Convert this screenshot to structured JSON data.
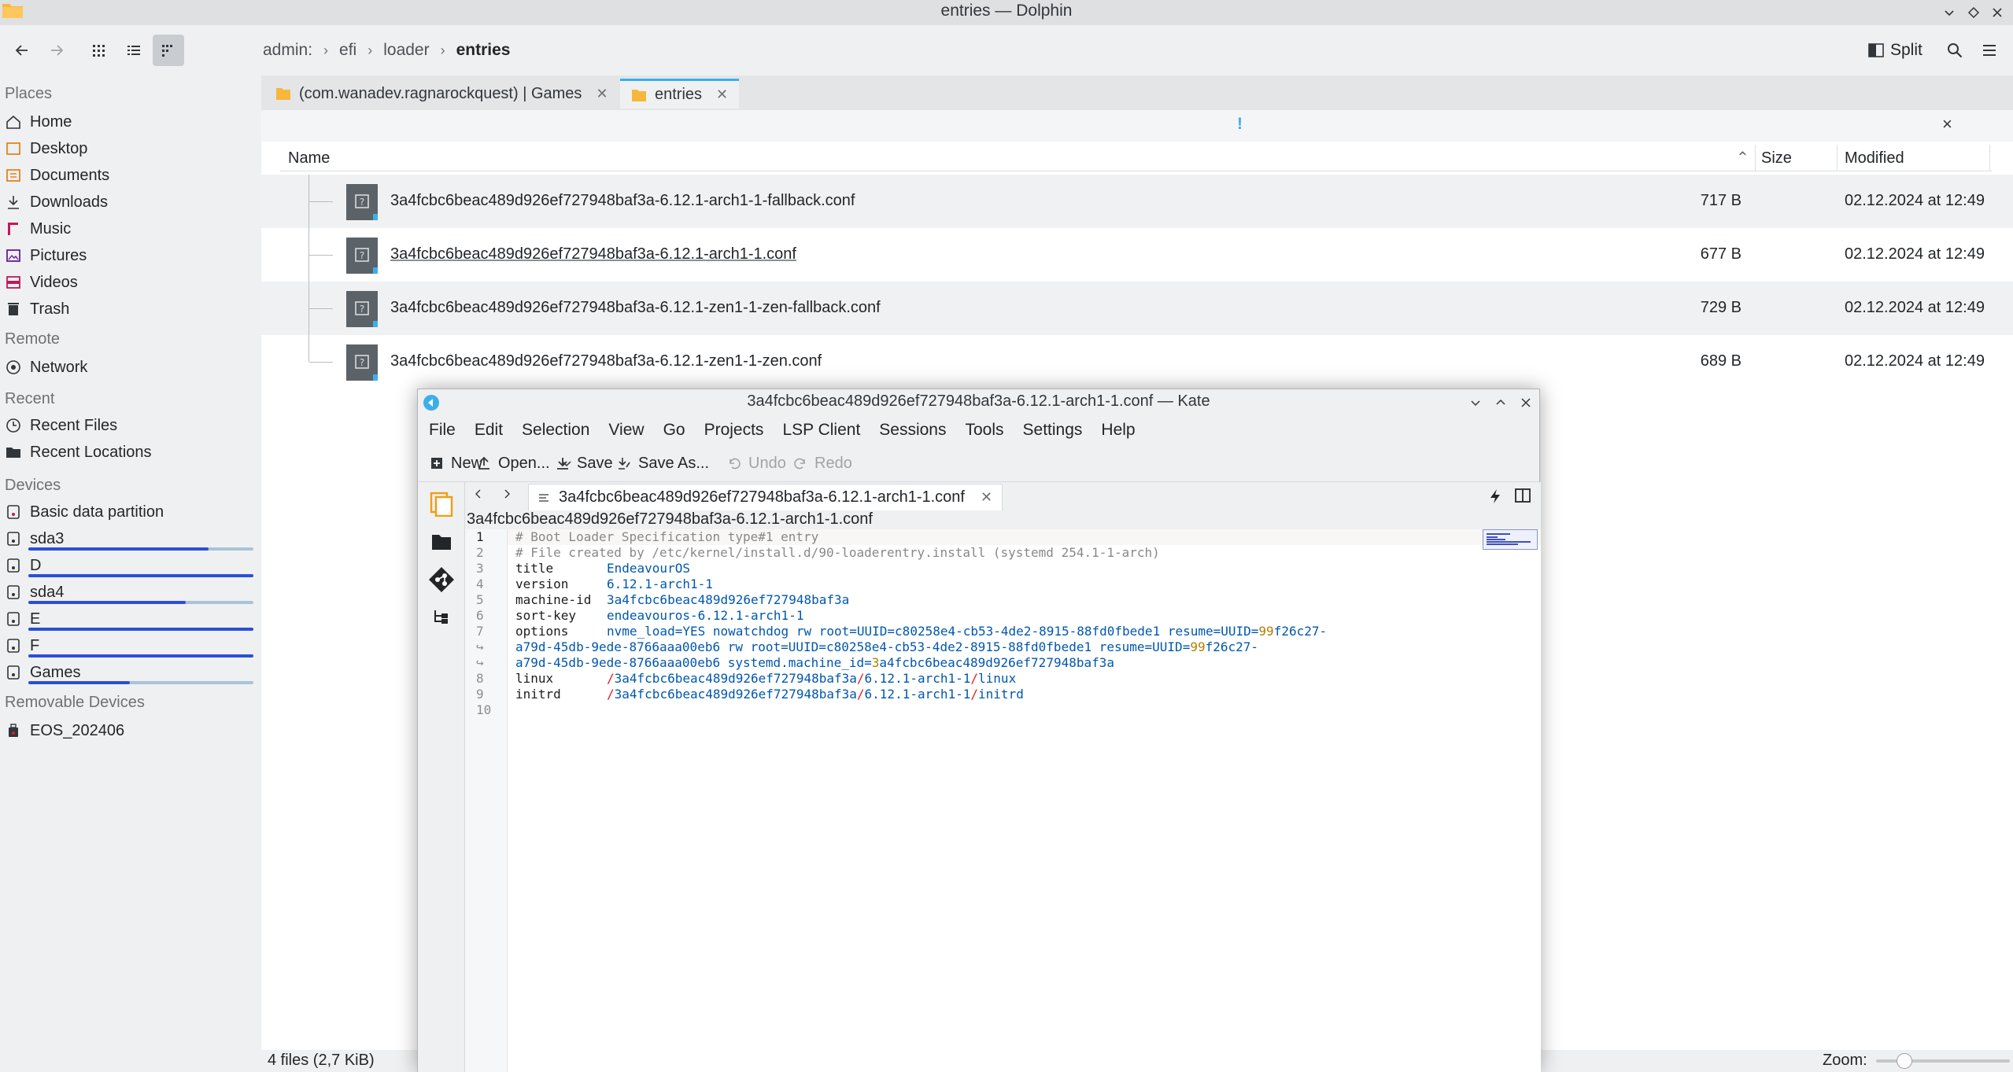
{
  "dolphin": {
    "title": "entries — Dolphin",
    "breadcrumb": [
      "admin:",
      "efi",
      "loader",
      "entries"
    ],
    "split_label": "Split",
    "tabs": [
      {
        "label": "(com.wanadev.ragnarockquest) | Games"
      },
      {
        "label": "entries"
      }
    ],
    "infobar_mark": "!",
    "infobar_close": "×",
    "columns": {
      "name": "Name",
      "size": "Size",
      "modified": "Modified"
    },
    "files": [
      {
        "name": "3a4fcbc6beac489d926ef727948baf3a-6.12.1-arch1-1-fallback.conf",
        "size": "717 B",
        "modified": "02.12.2024 at 12:49"
      },
      {
        "name": "3a4fcbc6beac489d926ef727948baf3a-6.12.1-arch1-1.conf",
        "size": "677 B",
        "modified": "02.12.2024 at 12:49"
      },
      {
        "name": "3a4fcbc6beac489d926ef727948baf3a-6.12.1-zen1-1-zen-fallback.conf",
        "size": "729 B",
        "modified": "02.12.2024 at 12:49"
      },
      {
        "name": "3a4fcbc6beac489d926ef727948baf3a-6.12.1-zen1-1-zen.conf",
        "size": "689 B",
        "modified": "02.12.2024 at 12:49"
      }
    ],
    "status_text": "4 files (2,7 KiB)",
    "zoom_label": "Zoom:"
  },
  "places": {
    "sections": {
      "places": "Places",
      "remote": "Remote",
      "recent": "Recent",
      "devices": "Devices",
      "removable": "Removable Devices"
    },
    "places_items": [
      "Home",
      "Desktop",
      "Documents",
      "Downloads",
      "Music",
      "Pictures",
      "Videos",
      "Trash"
    ],
    "remote_items": [
      "Network"
    ],
    "recent_items": [
      "Recent Files",
      "Recent Locations"
    ],
    "devices": [
      {
        "label": "Basic data partition",
        "usage": null
      },
      {
        "label": "sda3",
        "usage": 0.8
      },
      {
        "label": "D",
        "usage": 1.0
      },
      {
        "label": "sda4",
        "usage": 0.7
      },
      {
        "label": "E",
        "usage": 1.0
      },
      {
        "label": "F",
        "usage": 1.0
      },
      {
        "label": "Games",
        "usage": 0.45
      }
    ],
    "removable_items": [
      "EOS_202406"
    ]
  },
  "kate": {
    "title": "3a4fcbc6beac489d926ef727948baf3a-6.12.1-arch1-1.conf — Kate",
    "menu": [
      "File",
      "Edit",
      "Selection",
      "View",
      "Go",
      "Projects",
      "LSP Client",
      "Sessions",
      "Tools",
      "Settings",
      "Help"
    ],
    "toolbar": {
      "new": "New",
      "open": "Open...",
      "save": "Save",
      "save_as": "Save As...",
      "undo": "Undo",
      "redo": "Redo"
    },
    "doc_tab": "3a4fcbc6beac489d926ef727948baf3a-6.12.1-arch1-1.conf",
    "path": "3a4fcbc6beac489d926ef727948baf3a-6.12.1-arch1-1.conf",
    "line_numbers": [
      "1",
      "2",
      "3",
      "4",
      "5",
      "6",
      "7",
      "",
      "",
      "8",
      "9",
      "10"
    ],
    "lines": {
      "l1": "# Boot Loader Specification type#1 entry",
      "l2": "# File created by /etc/kernel/install.d/90-loaderentry.install (systemd 254.1-1-arch)",
      "l3k": "title",
      "l3v": "EndeavourOS",
      "l4k": "version",
      "l4v": "6.12.1-arch1-1",
      "l5k": "machine-id",
      "l5v": "3a4fcbc6beac489d926ef727948baf3a",
      "l6k": "sort-key",
      "l6v": "endeavouros-6.12.1-arch1-1",
      "l7k": "options",
      "l7a": "nvme_load=YES nowatchdog rw root=UUID=c80258e4-cb53-4de2-8915-88fd0fbede1 resume=UUID=",
      "l7b": "99",
      "l7c": "f26c27-",
      "w1a": "a79d-45db-9ede-8766aaa00eb6 rw root=UUID=c80258e4-cb53-4de2-8915-88fd0fbede1 resume=UUID=",
      "w1b": "99",
      "w1c": "f26c27-",
      "w2a": "a79d-45db-9ede-8766aaa00eb6 systemd.machine_id=",
      "w2b": "3",
      "w2c": "a4fcbc6beac489d926ef727948baf3a",
      "l8k": "linux",
      "l8a": "3a4fcbc6beac489d926ef727948baf3a",
      "l8b": "6.12.1-arch1-1",
      "l8c": "linux",
      "l9k": "initrd",
      "l9a": "3a4fcbc6beac489d926ef727948baf3a",
      "l9b": "6.12.1-arch1-1",
      "l9c": "initrd",
      "slash": "/"
    }
  }
}
